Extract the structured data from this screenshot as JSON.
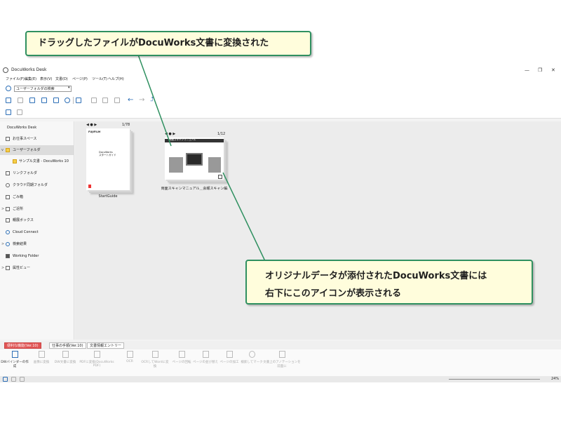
{
  "callouts": {
    "top": "ドラッグしたファイルがDocuWorks文書に変換された",
    "bottom_line1": "オリジナルデータが添付されたDocuWorks文書には",
    "bottom_line2": "右下にこのアイコンが表示される",
    "border_color": "#2f9060",
    "fill_color": "#fffddc"
  },
  "window": {
    "title": "DocuWorks Desk",
    "controls": [
      "—",
      "❐",
      "✕"
    ]
  },
  "menu": [
    "ファイル(F)",
    "編集(E)",
    "表示(V)",
    "文書(D)",
    "ページ(P)",
    "ツール(T)",
    "ヘルプ(H)"
  ],
  "search": {
    "value": "ユーザーフォルダの検索"
  },
  "sidebar": {
    "root": "DocuWorks Desk",
    "items": [
      {
        "label": "お仕事スペース",
        "icon": "workspace-icon"
      },
      {
        "label": "ユーザーフォルダ",
        "icon": "folder-icon"
      },
      {
        "label": "サンプル文書 - DocuWorks 10",
        "icon": "folder-icon"
      },
      {
        "label": "リンクフォルダ",
        "icon": "link-folder-icon"
      },
      {
        "label": "クラウド同期フォルダ",
        "icon": "cloud-folder-icon"
      },
      {
        "label": "ごみ箱",
        "icon": "trash-icon"
      },
      {
        "label": "ご近所",
        "icon": "neighborhood-icon"
      },
      {
        "label": "親展ボックス",
        "icon": "mailbox-icon"
      },
      {
        "label": "Cloud Connect",
        "icon": "cloud-icon"
      },
      {
        "label": "検索結果",
        "icon": "search-icon"
      },
      {
        "label": "Working Folder",
        "icon": "working-folder-icon"
      },
      {
        "label": "属性ビュー",
        "icon": "attribute-view-icon"
      }
    ]
  },
  "documents": [
    {
      "name": "StartGuide",
      "pages": "1/78",
      "cover_brand": "FUJIFILM",
      "cover_title": "DocuWorks\nスタートガイド"
    },
    {
      "name": "両面スキャンマニュアル＿会報スキャン編",
      "pages": "1/12",
      "cover_title": "両面スキャンマニュアル"
    }
  ],
  "tabs": [
    "便利な機能(Ver.10)",
    "仕事の手順(Ver.10)",
    "文書情報エントリー"
  ],
  "tab_colors": [
    "#e05555",
    "#5a8fd8",
    "#4caf50"
  ],
  "plugins": [
    {
      "label": "DWバインダーの作成",
      "enabled": true
    },
    {
      "label": "画像に変換",
      "enabled": false
    },
    {
      "label": "DW文書に変換",
      "enabled": false
    },
    {
      "label": "PDFに変換(DocuWorks PDF)",
      "enabled": false
    },
    {
      "label": "OCR",
      "enabled": false
    },
    {
      "label": "OCRしてWordに変換",
      "enabled": false
    },
    {
      "label": "ページの回転",
      "enabled": false
    },
    {
      "label": "ページの並び替え",
      "enabled": false
    },
    {
      "label": "ページの加工",
      "enabled": false
    },
    {
      "label": "検索してマーク",
      "enabled": false
    },
    {
      "label": "文書上のアノテーションを前面に",
      "enabled": false
    }
  ],
  "status": {
    "zoom": "24%"
  }
}
